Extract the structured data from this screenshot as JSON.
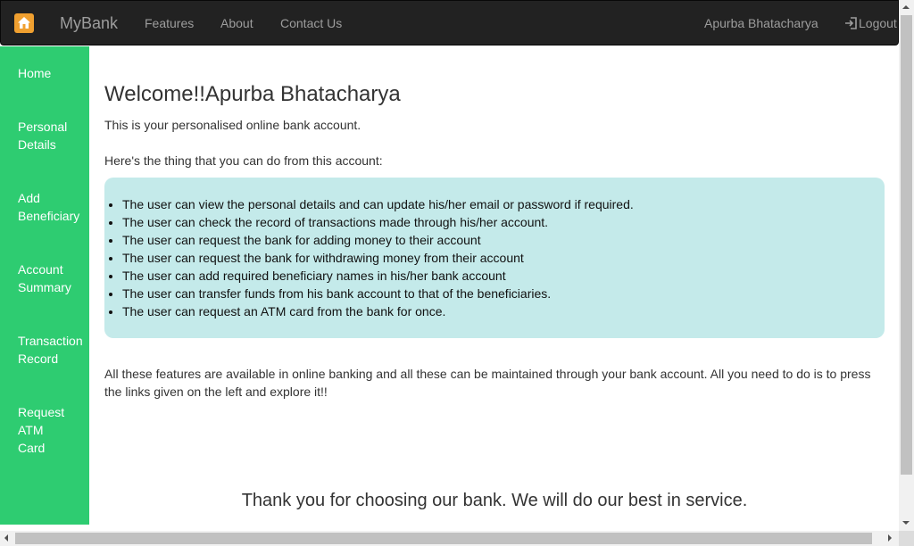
{
  "navbar": {
    "brand": "MyBank",
    "links": [
      "Features",
      "About",
      "Contact Us"
    ],
    "user_name": "Apurba Bhatacharya",
    "logout_label": "Logout",
    "home_icon": "home-icon",
    "logout_icon": "log-in-icon"
  },
  "sidebar": {
    "items": [
      {
        "line1": "Home",
        "line2": "",
        "line3": ""
      },
      {
        "line1": "Personal",
        "line2": "Details",
        "line3": ""
      },
      {
        "line1": "Add",
        "line2": "Beneficiary",
        "line3": ""
      },
      {
        "line1": "Account",
        "line2": "Summary",
        "line3": ""
      },
      {
        "line1": "Transaction",
        "line2": "Record",
        "line3": ""
      },
      {
        "line1": "Request",
        "line2": "ATM",
        "line3": "Card"
      }
    ]
  },
  "main": {
    "welcome": "Welcome!!Apurba Bhatacharya",
    "intro": "This is your personalised online bank account.",
    "intro2": "Here's the thing that you can do from this account:",
    "features": [
      "The user can view the personal details and can update his/her email or password if required.",
      "The user can check the record of transactions made through his/her account.",
      "The user can request the bank for adding money to their account",
      "The user can request the bank for withdrawing money from their account",
      "The user can add required beneficiary names in his/her bank account",
      "The user can transfer funds from his bank account to that of the beneficiaries.",
      "The user can request an ATM card from the bank for once."
    ],
    "outro": "All these features are available in online banking and all these can be maintained through your bank account. All you need to do is to press the links given on the left and explore it!!",
    "thanks": "Thank you for choosing our bank. We will do our best in service."
  },
  "colors": {
    "navbar_bg": "#222222",
    "sidebar_bg": "#2ecc71",
    "feature_box_bg": "#c4eaea",
    "nav_text": "#9d9d9d"
  }
}
